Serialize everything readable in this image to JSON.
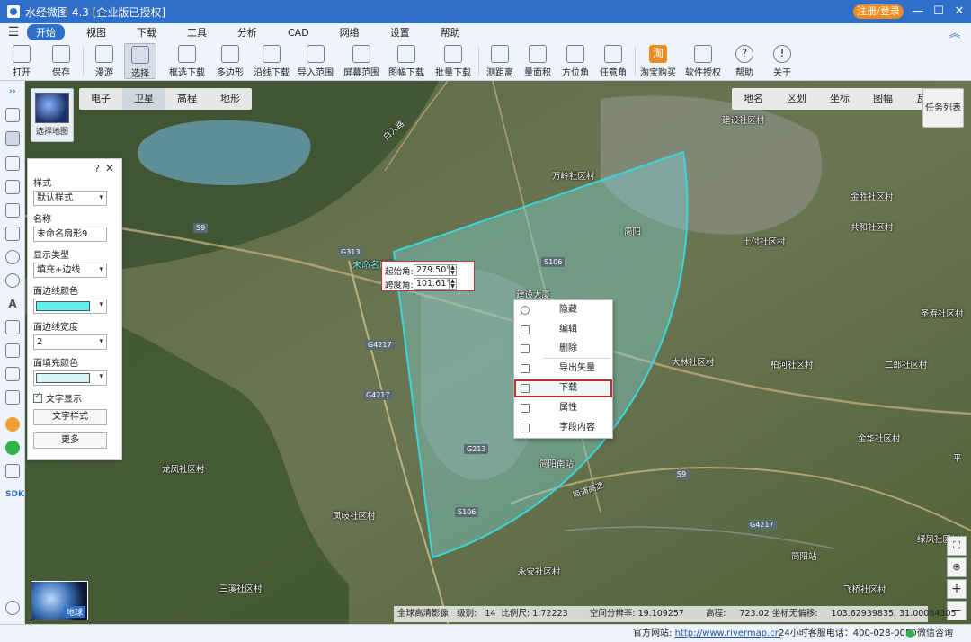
{
  "window": {
    "title": "水经微图 4.3 [企业版已授权]",
    "login_label": "注册/登录",
    "minimize": "—",
    "maximize": "☐",
    "close": "✕"
  },
  "menu": {
    "items": [
      "开始",
      "视图",
      "下载",
      "工具",
      "分析",
      "CAD",
      "网络",
      "设置",
      "帮助"
    ],
    "active": "开始",
    "collapse_icon": "chevron-up-icon"
  },
  "toolbar": {
    "items": [
      {
        "label": "打开",
        "icon": "folder-icon"
      },
      {
        "label": "保存",
        "icon": "save-icon"
      },
      {
        "label": "漫游",
        "icon": "hand-icon"
      },
      {
        "label": "选择",
        "icon": "cursor-icon"
      },
      {
        "label": "框选下载",
        "icon": "box-download-icon"
      },
      {
        "label": "多边形",
        "icon": "polygon-icon"
      },
      {
        "label": "沿线下载",
        "icon": "line-download-icon"
      },
      {
        "label": "导入范围",
        "icon": "import-range-icon"
      },
      {
        "label": "屏幕范围",
        "icon": "screen-range-icon"
      },
      {
        "label": "图幅下载",
        "icon": "sheet-download-icon"
      },
      {
        "label": "批量下载",
        "icon": "batch-download-icon"
      },
      {
        "label": "测距离",
        "icon": "ruler-icon"
      },
      {
        "label": "量面积",
        "icon": "area-icon"
      },
      {
        "label": "方位角",
        "icon": "azimuth-icon"
      },
      {
        "label": "任意角",
        "icon": "angle-icon"
      },
      {
        "label": "淘宝购买",
        "icon": "taobao-icon",
        "glyph": "淘"
      },
      {
        "label": "软件授权",
        "icon": "lock-icon"
      },
      {
        "label": "帮助",
        "icon": "help-icon",
        "glyph": "?"
      },
      {
        "label": "关于",
        "icon": "info-icon",
        "glyph": "!"
      }
    ]
  },
  "map": {
    "layer_card_caption": "选择地图",
    "tabs_left": [
      "电子",
      "卫星",
      "高程",
      "地形"
    ],
    "tabs_left_active": "卫星",
    "tabs_right": [
      "地名",
      "区划",
      "坐标",
      "图幅",
      "瓦片"
    ],
    "task_list": "任务列表",
    "globe_label": "地球",
    "sector_color": "#39d6dc",
    "labels": [
      "建设社区村",
      "万岭社区村",
      "金胜社区村",
      "共和社区村",
      "土付社区村",
      "圣寿社区村",
      "大林社区村",
      "柏河社区村",
      "二郎社区村",
      "金华社区村",
      "龙凤社区村",
      "凤岐社区村",
      "三溪社区村",
      "永安社区村",
      "飞桥社区村",
      "绿凤社区村",
      "平",
      "建设大厦",
      "未命名扇形9"
    ],
    "road_labels": [
      "S9",
      "G313",
      "G4217",
      "S106",
      "G213",
      "G4217",
      "S9",
      "G4217",
      "S106"
    ],
    "station_labels": [
      "简阳南站",
      "简阳",
      "简阳站"
    ],
    "road_text": [
      "白入路",
      "简浦高速"
    ]
  },
  "style_panel": {
    "help": "?",
    "close": "✕",
    "style_label": "样式",
    "style_value": "默认样式",
    "name_label": "名称",
    "name_value": "未命名扇形9",
    "display_label": "显示类型",
    "display_value": "填充+边线",
    "edge_color_label": "面边线颜色",
    "edge_color": "#5ff0ee",
    "edge_width_label": "面边线宽度",
    "edge_width_value": "2",
    "fill_color_label": "面填充颜色",
    "fill_color": "#d7f5f7",
    "text_display_label": "文字显示",
    "text_style_button": "文字样式",
    "more_button": "更多"
  },
  "angle_popup": {
    "start_label": "起始角:",
    "start_value": "279.50°",
    "span_label": "跨度角:",
    "span_value": "101.61°"
  },
  "context_menu": {
    "items": [
      "隐藏",
      "编辑",
      "删除",
      "导出矢量",
      "下载",
      "属性",
      "字段内容"
    ],
    "highlighted": "下载"
  },
  "map_info": {
    "source": "全球高清影像",
    "level_label": "级别:",
    "level": "14",
    "scale_label": "比例尺:",
    "scale": "1:72223",
    "resolution_label": "空间分辨率:",
    "resolution": "19.109257",
    "elevation_label": "高程:",
    "elevation": "723.02",
    "offset_label": "坐标无偏移:",
    "coords": "103.62939835, 31.00084305"
  },
  "status": {
    "site_label": "官方网站:",
    "site_url": "http://www.rivermap.cn",
    "phone": "24小时客服电话：400-028-0050",
    "wechat": "微信咨询"
  }
}
